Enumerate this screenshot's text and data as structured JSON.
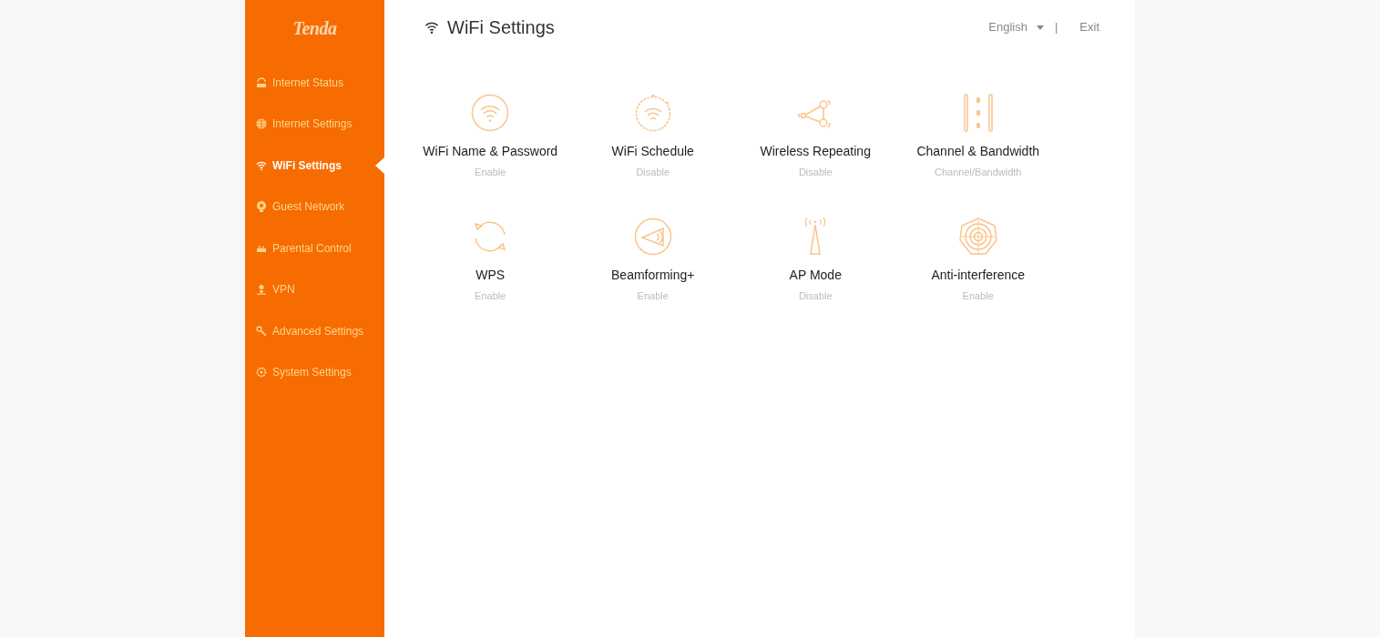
{
  "logo": "Tenda",
  "sidebar": {
    "items": [
      {
        "label": "Internet Status",
        "selected": false
      },
      {
        "label": "Internet Settings",
        "selected": false
      },
      {
        "label": "WiFi Settings",
        "selected": true
      },
      {
        "label": "Guest Network",
        "selected": false
      },
      {
        "label": "Parental Control",
        "selected": false
      },
      {
        "label": "VPN",
        "selected": false
      },
      {
        "label": "Advanced Settings",
        "selected": false
      },
      {
        "label": "System Settings",
        "selected": false
      }
    ]
  },
  "header": {
    "title": "WiFi Settings",
    "language": "English",
    "separator": "|",
    "exit": "Exit"
  },
  "tiles": [
    {
      "title": "WiFi Name & Password",
      "status": "Enable"
    },
    {
      "title": "WiFi Schedule",
      "status": "Disable"
    },
    {
      "title": "Wireless Repeating",
      "status": "Disable"
    },
    {
      "title": "Channel & Bandwidth",
      "status": "Channel/Bandwidth"
    },
    {
      "title": "WPS",
      "status": "Enable"
    },
    {
      "title": "Beamforming+",
      "status": "Enable"
    },
    {
      "title": "AP Mode",
      "status": "Disable"
    },
    {
      "title": "Anti-interference",
      "status": "Enable"
    }
  ]
}
